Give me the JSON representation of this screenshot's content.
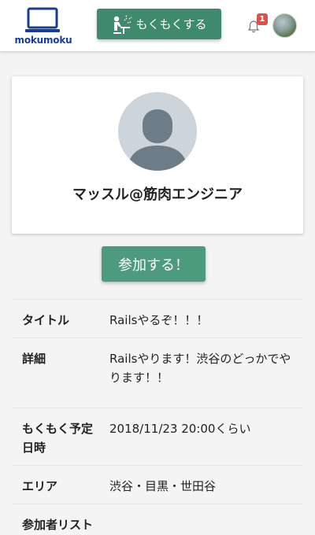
{
  "header": {
    "logo_text": "mokumoku",
    "mokumoku_button_label": "もくもくする",
    "notification_count": "1",
    "icons": [
      "laptop-icon",
      "worker-icon",
      "bell-icon",
      "avatar"
    ]
  },
  "profile": {
    "name": "マッスル@筋肉エンジニア"
  },
  "join_button_label": "参加する！",
  "details": [
    {
      "label": "タイトル",
      "value": "Railsやるぞ！！！"
    },
    {
      "label": "詳細",
      "value": "Railsやります！渋谷のどっかでやります！！"
    },
    {
      "label": "もくもく予定日時",
      "value": "2018/11/23 20:00くらい"
    },
    {
      "label": "エリア",
      "value": "渋谷・目黒・世田谷"
    },
    {
      "label": "参加者リスト",
      "value": ""
    }
  ],
  "colors": {
    "accent_green": "#3f8a6f",
    "join_green": "#4d9a7f",
    "logo_blue": "#1b3d8f",
    "badge_red": "#d9534f"
  }
}
